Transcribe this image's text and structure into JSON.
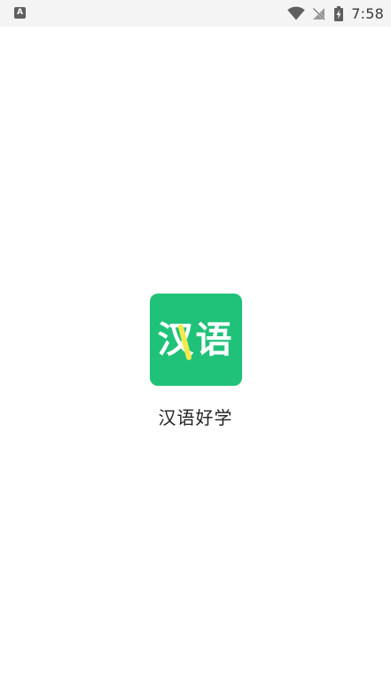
{
  "status_bar": {
    "notification_badge": "A",
    "time": "7:58"
  },
  "splash": {
    "logo": {
      "char_1": "汉",
      "char_2": "语",
      "background_color": "#20c27a",
      "accent_color": "#f2e94e"
    },
    "app_name": "汉语好学"
  }
}
